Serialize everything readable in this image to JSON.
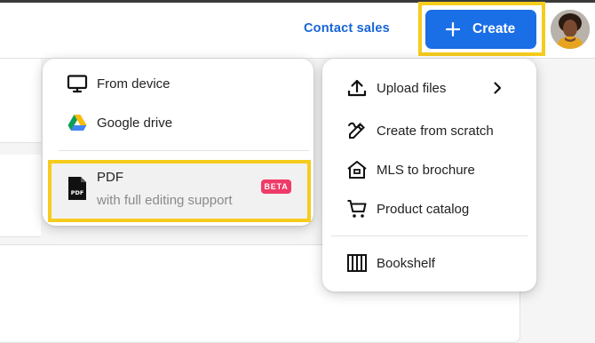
{
  "header": {
    "contact_label": "Contact sales",
    "create_label": "Create"
  },
  "source_menu": {
    "items": [
      {
        "label": "From device",
        "icon": "monitor-icon"
      },
      {
        "label": "Google drive",
        "icon": "google-drive-icon"
      }
    ],
    "pdf": {
      "title": "PDF",
      "subtitle": "with full editing support",
      "badge": "BETA",
      "icon": "pdf-file-icon"
    }
  },
  "create_menu": {
    "items": [
      {
        "label": "Upload files",
        "icon": "upload-icon"
      },
      {
        "label": "Create from scratch",
        "icon": "pen-icon"
      },
      {
        "label": "MLS to brochure",
        "icon": "house-icon"
      },
      {
        "label": "Product catalog",
        "icon": "cart-icon"
      },
      {
        "label": "Bookshelf",
        "icon": "bookshelf-icon"
      }
    ]
  },
  "colors": {
    "accent": "#1a6ee6",
    "link": "#1565d8",
    "highlight": "#f6cc1c",
    "badge": "#ef3a67"
  }
}
